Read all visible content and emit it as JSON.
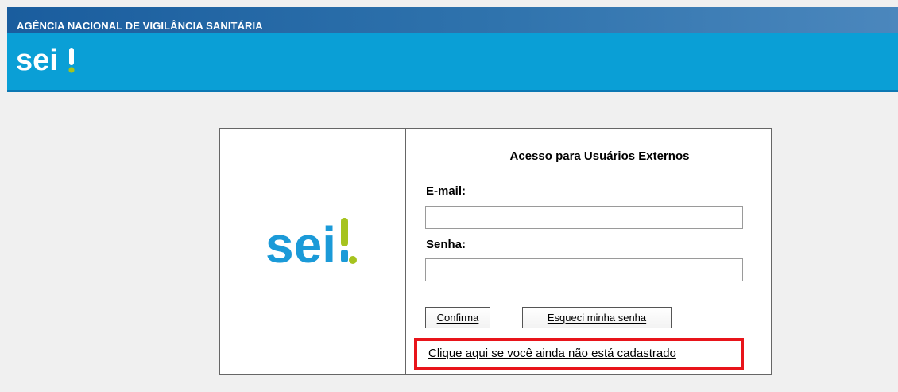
{
  "header": {
    "agency_name": "AGÊNCIA NACIONAL DE VIGILÂNCIA SANITÁRIA",
    "logo_text": "sei",
    "logo_accent_color": "#a6c31e",
    "bar_color": "#0a9fd6"
  },
  "login": {
    "logo_text": "sei",
    "logo_color": "#1b9ad8",
    "logo_accent_color": "#a6c31e",
    "title": "Acesso para Usuários Externos",
    "email_label": "E-mail:",
    "email_value": "",
    "password_label": "Senha:",
    "password_value": "",
    "confirm_button": "Confirma",
    "forgot_button": "Esqueci minha senha",
    "register_link": "Clique aqui se você ainda não está cadastrado",
    "highlight_color": "#e8141a"
  }
}
